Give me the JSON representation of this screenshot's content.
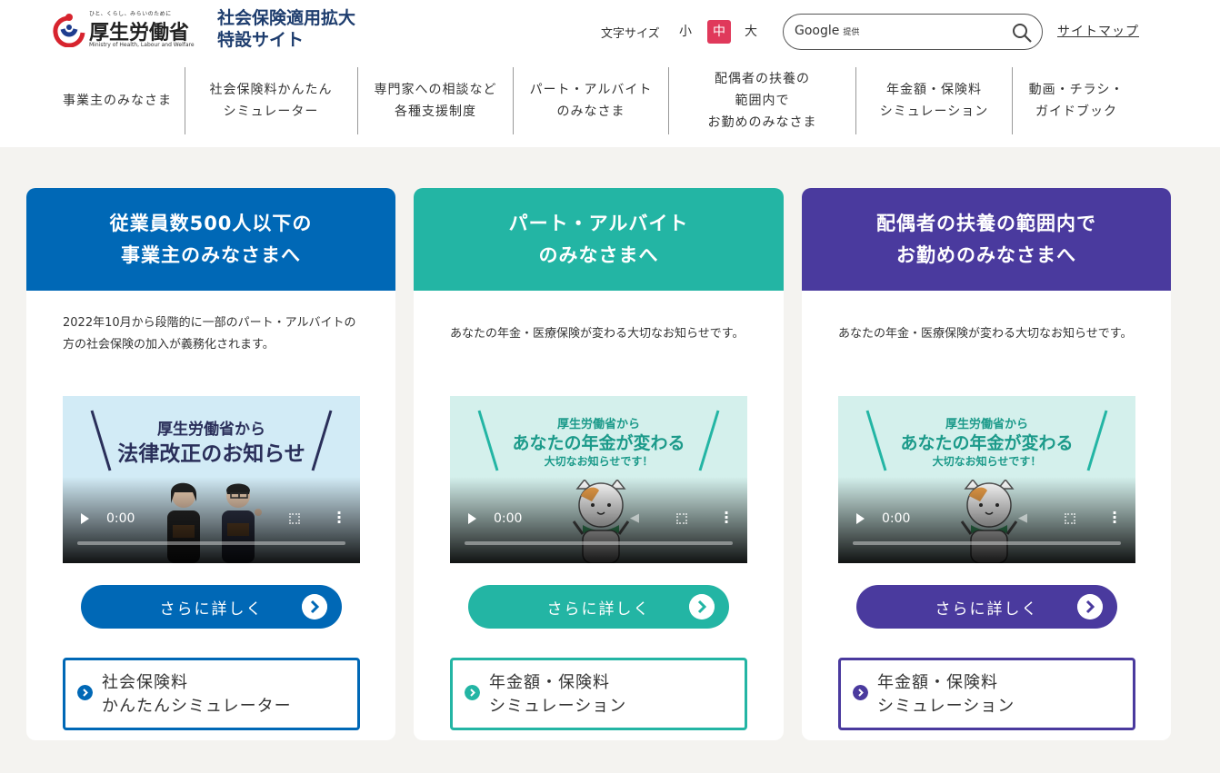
{
  "header": {
    "logo_tagline": "ひと、くらし、みらいのために",
    "logo_ministry": "厚生労働省",
    "logo_en": "Ministry of Health, Labour and Welfare",
    "site_title_line1": "社会保険適用拡大",
    "site_title_line2": "特設サイト",
    "font_size_label": "文字サイズ",
    "font_size_options": [
      "小",
      "中",
      "大"
    ],
    "font_size_selected": "中",
    "search_brand": "Google",
    "search_brand_suffix": "提供",
    "search_placeholder": "",
    "sitemap_label": "サイトマップ"
  },
  "nav": [
    "事業主のみなさま",
    "社会保険料かんたん\nシミュレーター",
    "専門家への相談など\n各種支援制度",
    "パート・アルバイト\nのみなさま",
    "配偶者の扶養の\n範囲内で\nお勤めのみなさま",
    "年金額・保険料\nシミュレーション",
    "動画・チラシ・\nガイドブック"
  ],
  "cards": [
    {
      "title": "従業員数500人以下の\n事業主のみなさまへ",
      "text": "2022年10月から段階的に一部のパート・アルバイトの方の社会保険の加入が義務化されます。",
      "video_title_line1": "厚生労働省から",
      "video_title_line2": "法律改正のお知らせ",
      "video_time": "0:00",
      "more_label": "さらに詳しく",
      "link_label": "社会保険料\nかんたんシミュレーター"
    },
    {
      "title": "パート・アルバイト\nのみなさまへ",
      "text": "あなたの年金・医療保険が変わる大切なお知らせです。",
      "video_title_line1": "厚生労働省から",
      "video_title_line2": "あなたの年金が変わる",
      "video_title_line3": "大切なお知らせです！",
      "video_time": "0:00",
      "more_label": "さらに詳しく",
      "link_label": "年金額・保険料\nシミュレーション"
    },
    {
      "title": "配偶者の扶養の範囲内で\nお勤めのみなさまへ",
      "text": "あなたの年金・医療保険が変わる大切なお知らせです。",
      "video_title_line1": "厚生労働省から",
      "video_title_line2": "あなたの年金が変わる",
      "video_title_line3": "大切なお知らせです！",
      "video_time": "0:00",
      "more_label": "さらに詳しく",
      "link_label": "年金額・保険料\nシミュレーション"
    }
  ],
  "colors": {
    "card1": "#0068b6",
    "card2": "#23b5a4",
    "card3": "#4a3a9e",
    "font_size_active": "#e0395b",
    "site_title": "#1e3d6e"
  }
}
